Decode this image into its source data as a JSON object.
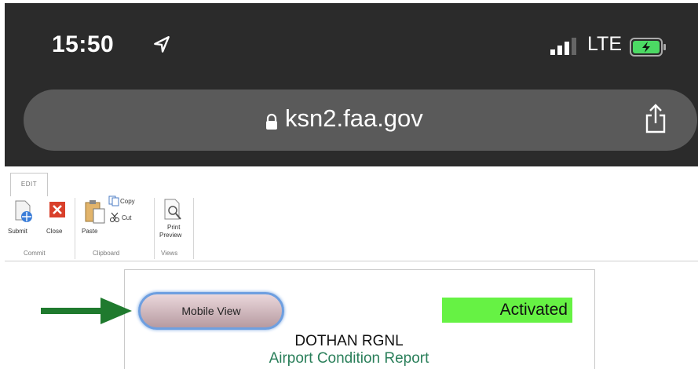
{
  "status_bar": {
    "time": "15:50",
    "network": "LTE"
  },
  "browser": {
    "url": "ksn2.faa.gov"
  },
  "ribbon": {
    "tab": "EDIT",
    "commit": {
      "submit": "Submit",
      "close": "Close",
      "group": "Commit"
    },
    "clipboard": {
      "paste": "Paste",
      "copy": "Copy",
      "cut": "Cut",
      "group": "Clipboard"
    },
    "views": {
      "print_line1": "Print",
      "print_line2": "Preview",
      "group": "Views"
    }
  },
  "content": {
    "mobile_view_label": "Mobile View",
    "status_label": "Activated",
    "airport_name": "DOTHAN RGNL",
    "report_title": "Airport Condition Report"
  },
  "colors": {
    "activated_bg": "#66f244",
    "arrow": "#1f7a2e",
    "report_title": "#2a7f5a"
  }
}
